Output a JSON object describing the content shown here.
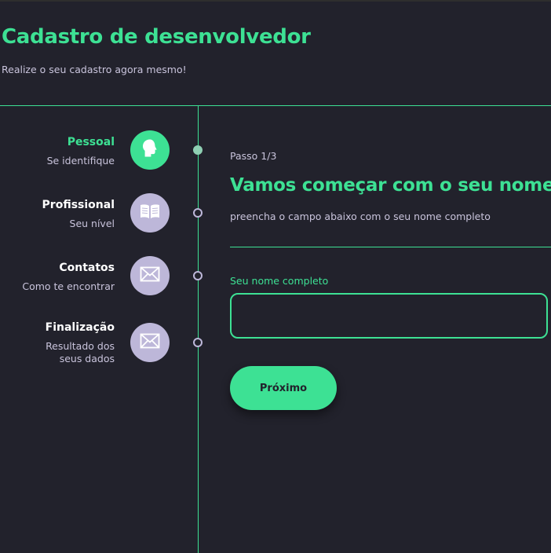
{
  "header": {
    "title": "Cadastro de desenvolvedor",
    "subtitle": "Realize o seu cadastro agora mesmo!"
  },
  "steps": [
    {
      "name": "Pessoal",
      "description": "Se identifique",
      "icon": "head-icon",
      "active": true
    },
    {
      "name": "Profissional",
      "description": "Seu nível",
      "icon": "book-icon",
      "active": false
    },
    {
      "name": "Contatos",
      "description": "Como te encontrar",
      "icon": "mail-icon",
      "active": false
    },
    {
      "name": "Finalização",
      "description": "Resultado dos seus dados",
      "icon": "mail-icon",
      "active": false
    }
  ],
  "form": {
    "step_counter": "Passo 1/3",
    "heading": "Vamos começar com o seu nome",
    "description": "preencha o campo abaixo com o seu nome completo",
    "name_label": "Seu nome completo",
    "name_value": "",
    "next_label": "Próximo"
  },
  "colors": {
    "accent": "#3de194",
    "background": "#22222c",
    "muted_text": "#c9c4dc",
    "inactive_circle": "#bdb7d9"
  }
}
